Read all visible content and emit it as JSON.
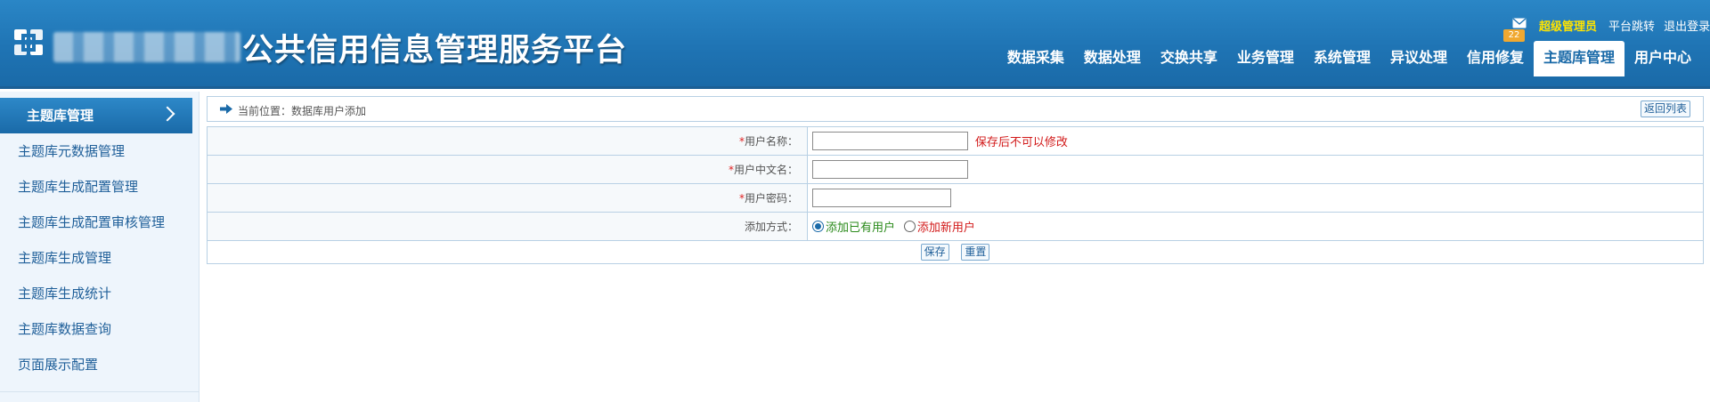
{
  "header": {
    "site_title": "公共信用信息管理服务平台",
    "mail_count": "22",
    "admin_name": "超级管理员",
    "platform_switch": "平台跳转",
    "logout": "退出登录",
    "colors": {
      "header_bg": "#1f74b4",
      "admin_name": "#ffe400",
      "badge": "#f0a830"
    }
  },
  "nav": {
    "items": [
      {
        "label": "数据采集"
      },
      {
        "label": "数据处理"
      },
      {
        "label": "交换共享"
      },
      {
        "label": "业务管理"
      },
      {
        "label": "系统管理"
      },
      {
        "label": "异议处理"
      },
      {
        "label": "信用修复"
      },
      {
        "label": "主题库管理"
      },
      {
        "label": "用户中心"
      }
    ],
    "active": "主题库管理"
  },
  "sidebar": {
    "header": "主题库管理",
    "items": [
      {
        "label": "主题库元数据管理"
      },
      {
        "label": "主题库生成配置管理"
      },
      {
        "label": "主题库生成配置审核管理"
      },
      {
        "label": "主题库生成管理"
      },
      {
        "label": "主题库生成统计"
      },
      {
        "label": "主题库数据查询"
      },
      {
        "label": "页面展示配置"
      }
    ]
  },
  "breadcrumb": {
    "text": "当前位置：数据库用户添加",
    "back_label": "返回列表"
  },
  "form": {
    "username": {
      "label": "用户名称：",
      "value": "",
      "hint": "保存后不可以修改"
    },
    "cn_name": {
      "label": "用户中文名：",
      "value": ""
    },
    "password": {
      "label": "用户密码：",
      "value": ""
    },
    "add_method": {
      "label": "添加方式：",
      "options": [
        "添加已有用户",
        "添加新用户"
      ],
      "selected": "添加已有用户"
    },
    "required_mark": "*",
    "save_label": "保存",
    "reset_label": "重置"
  }
}
